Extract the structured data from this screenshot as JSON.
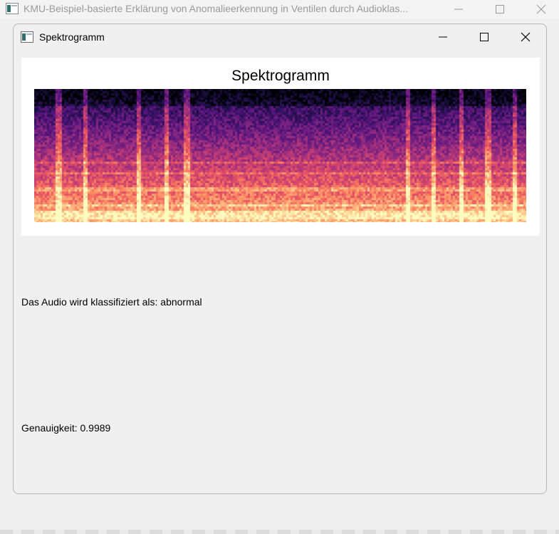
{
  "outer_window": {
    "title": "KMU-Beispiel-basierte Erklärung von Anomalieerkennung in Ventilen durch Audioklas..."
  },
  "child_window": {
    "title": "Spektrogramm"
  },
  "figure": {
    "title": "Spektrogramm",
    "colormap": "magma"
  },
  "result": {
    "classification_text": "Das Audio wird klassifiziert als: abnormal",
    "accuracy_text": "Genauigkeit: 0.9989"
  },
  "icons": {
    "minimize": "minimize-icon",
    "maximize": "maximize-icon",
    "close": "close-icon",
    "app": "app-window-icon"
  }
}
